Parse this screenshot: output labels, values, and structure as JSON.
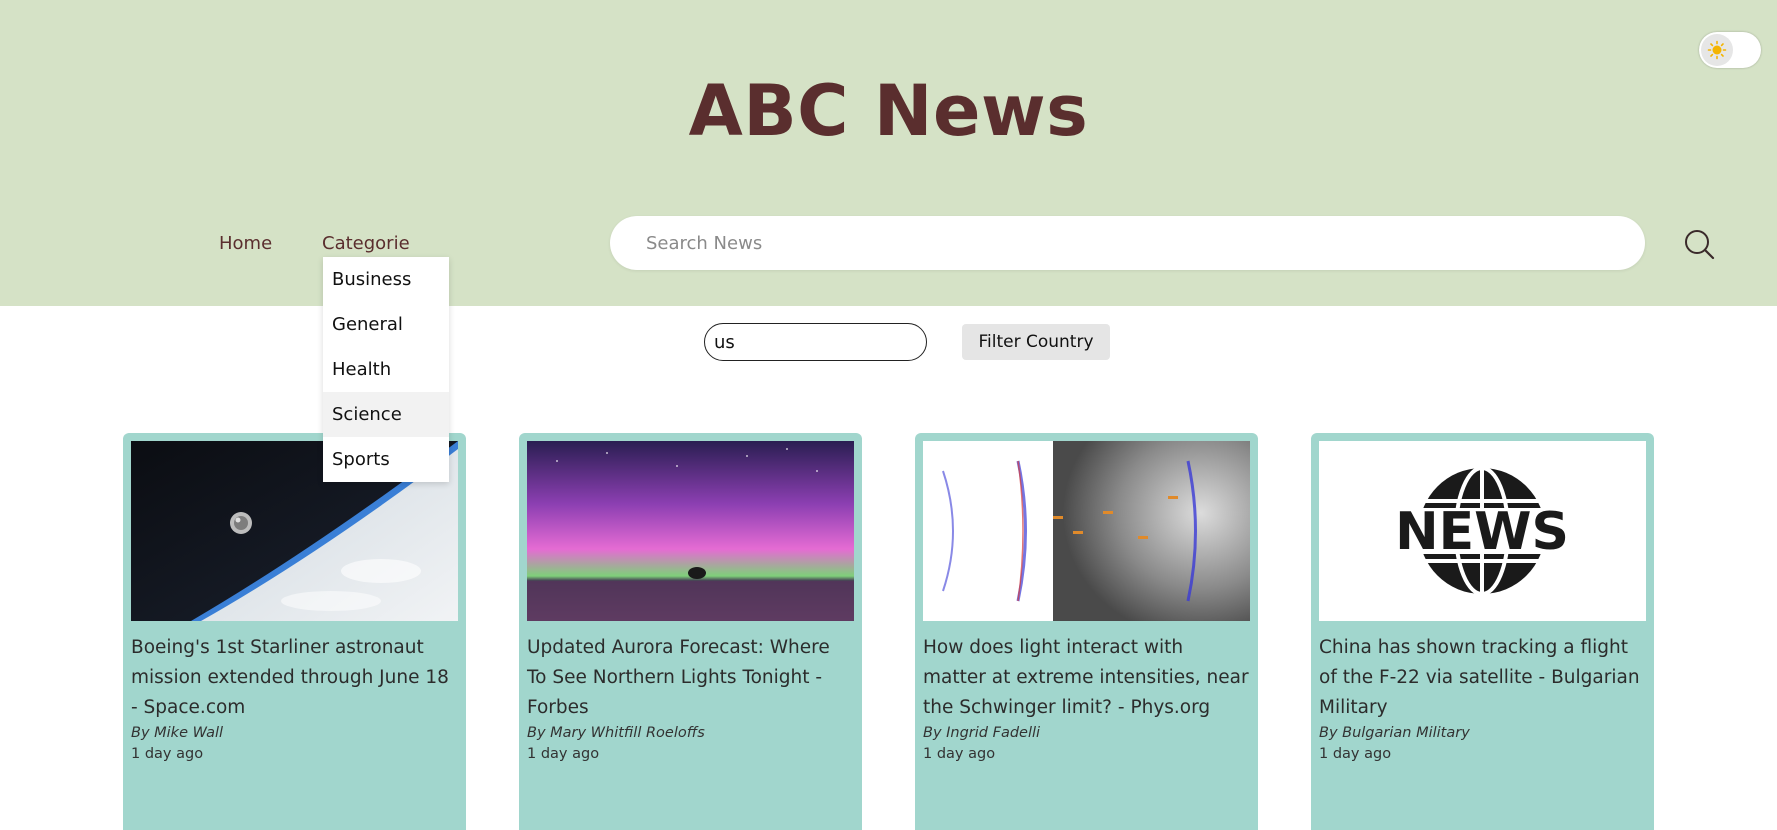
{
  "header": {
    "title": "ABC News",
    "bg_color": "#d5e2c6",
    "title_color": "#5a2e2e"
  },
  "theme_toggle": {
    "icon": "sun-icon"
  },
  "nav": {
    "home_label": "Home",
    "categories_label": "Categorie",
    "categories": [
      "Business",
      "General",
      "Health",
      "Science",
      "Sports"
    ],
    "hovered": "Science"
  },
  "search": {
    "placeholder": "Search News",
    "icon": "search-icon"
  },
  "filter": {
    "country_value": "us",
    "button_label": "Filter Country"
  },
  "cards": [
    {
      "title": "Boeing's 1st Starliner astronaut mission extended through June 18 - Space.com",
      "author": "By Mike Wall",
      "time": "1 day ago",
      "image": "spacecraft-over-earth"
    },
    {
      "title": "Updated Aurora Forecast: Where To See Northern Lights Tonight - Forbes",
      "author": "By Mary Whitfill Roeloffs",
      "time": "1 day ago",
      "image": "aurora-over-lake"
    },
    {
      "title": "How does light interact with matter at extreme intensities, near the Schwinger limit? - Phys.org",
      "author": "By Ingrid Fadelli",
      "time": "1 day ago",
      "image": "light-matter-simulation"
    },
    {
      "title": "China has shown tracking a flight of the F-22 via satellite - Bulgarian Military",
      "author": "By Bulgarian Military",
      "time": "1 day ago",
      "image": "news-globe-logo",
      "image_text": "NEWS"
    }
  ],
  "colors": {
    "card_bg": "#a1d6cd",
    "accent": "#5a2e2e"
  }
}
